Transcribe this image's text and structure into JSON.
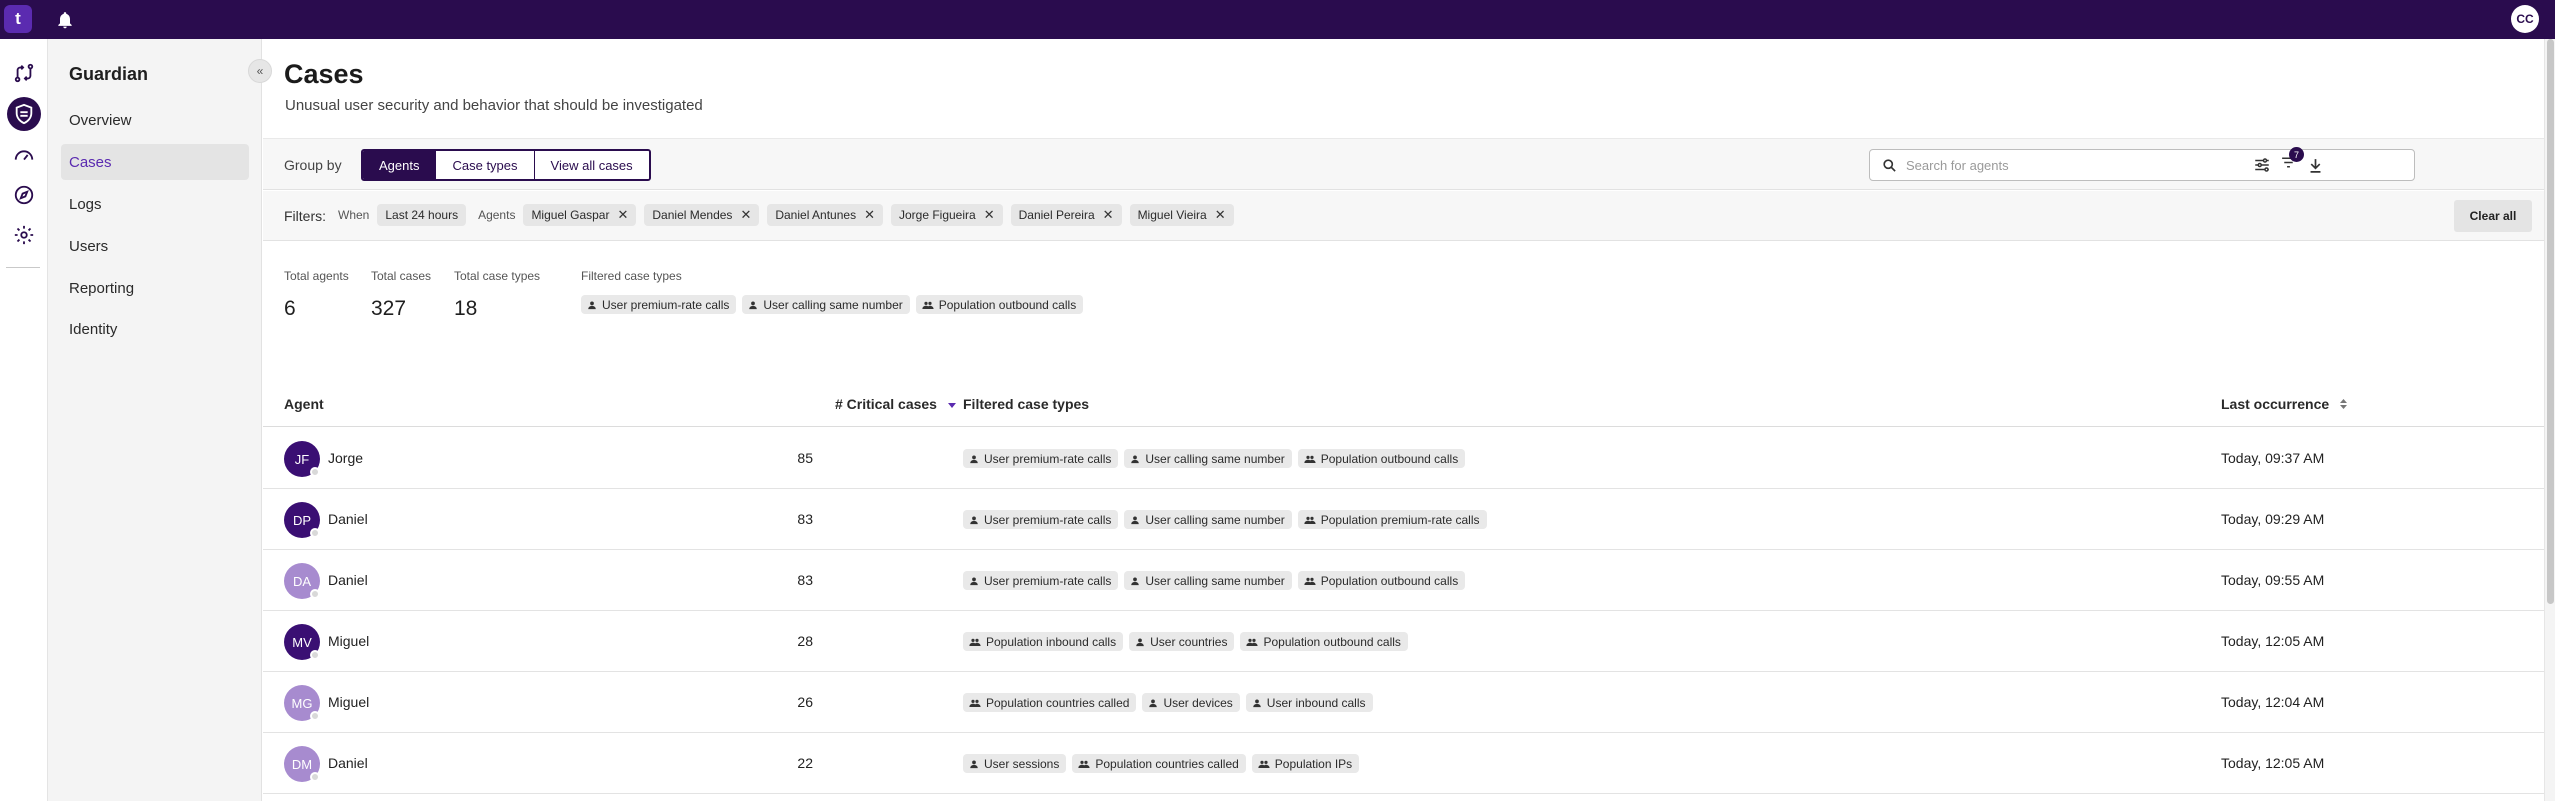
{
  "topbar": {
    "logo": "t",
    "user_initials": "CC"
  },
  "rail": {
    "icons": [
      "workflow-icon",
      "shield-icon",
      "speedometer-icon",
      "compass-icon",
      "gear-icon"
    ],
    "active_index": 1
  },
  "nav": {
    "title": "Guardian",
    "items": [
      {
        "label": "Overview",
        "active": false
      },
      {
        "label": "Cases",
        "active": true
      },
      {
        "label": "Logs",
        "active": false
      },
      {
        "label": "Users",
        "active": false
      },
      {
        "label": "Reporting",
        "active": false
      },
      {
        "label": "Identity",
        "active": false
      }
    ]
  },
  "page": {
    "title": "Cases",
    "subtitle": "Unusual user security and behavior that should be investigated"
  },
  "groupby": {
    "label": "Group by",
    "options": [
      {
        "label": "Agents",
        "selected": true
      },
      {
        "label": "Case types",
        "selected": false
      },
      {
        "label": "View all cases",
        "selected": false
      }
    ]
  },
  "search": {
    "placeholder": "Search for agents",
    "value": ""
  },
  "toolbar": {
    "filter_badge": "7"
  },
  "filters": {
    "label": "Filters:",
    "when_label": "When",
    "when_value": "Last 24 hours",
    "agents_label": "Agents",
    "agents": [
      "Miguel Gaspar",
      "Daniel Mendes",
      "Daniel Antunes",
      "Jorge Figueira",
      "Daniel Pereira",
      "Miguel Vieira"
    ],
    "clear_all": "Clear all"
  },
  "stats": {
    "total_agents_label": "Total agents",
    "total_agents": "6",
    "total_cases_label": "Total cases",
    "total_cases": "327",
    "total_case_types_label": "Total case types",
    "total_case_types": "18",
    "filtered_label": "Filtered case types",
    "filtered_types": [
      {
        "label": "User premium-rate calls",
        "kind": "user"
      },
      {
        "label": "User calling same number",
        "kind": "user"
      },
      {
        "label": "Population outbound calls",
        "kind": "population"
      }
    ]
  },
  "table": {
    "headers": {
      "agent": "Agent",
      "critical": "# Critical cases",
      "types": "Filtered case types",
      "last": "Last occurrence"
    },
    "rows": [
      {
        "initials": "JF",
        "name": "Jorge",
        "color": "#3a0f73",
        "count": "85",
        "last": "Today, 09:37 AM",
        "types": [
          {
            "label": "User premium-rate calls",
            "kind": "user"
          },
          {
            "label": "User calling same number",
            "kind": "user"
          },
          {
            "label": "Population outbound calls",
            "kind": "population"
          }
        ]
      },
      {
        "initials": "DP",
        "name": "Daniel",
        "color": "#3a0f73",
        "count": "83",
        "last": "Today, 09:29 AM",
        "types": [
          {
            "label": "User premium-rate calls",
            "kind": "user"
          },
          {
            "label": "User calling same number",
            "kind": "user"
          },
          {
            "label": "Population premium-rate calls",
            "kind": "population"
          }
        ]
      },
      {
        "initials": "DA",
        "name": "Daniel",
        "color": "#a78bcf",
        "count": "83",
        "last": "Today, 09:55 AM",
        "types": [
          {
            "label": "User premium-rate calls",
            "kind": "user"
          },
          {
            "label": "User calling same number",
            "kind": "user"
          },
          {
            "label": "Population outbound calls",
            "kind": "population"
          }
        ]
      },
      {
        "initials": "MV",
        "name": "Miguel",
        "color": "#3a0f73",
        "count": "28",
        "last": "Today, 12:05 AM",
        "types": [
          {
            "label": "Population inbound calls",
            "kind": "population"
          },
          {
            "label": "User countries",
            "kind": "user"
          },
          {
            "label": "Population outbound calls",
            "kind": "population"
          }
        ]
      },
      {
        "initials": "MG",
        "name": "Miguel",
        "color": "#a78bcf",
        "count": "26",
        "last": "Today, 12:04 AM",
        "types": [
          {
            "label": "Population countries called",
            "kind": "population"
          },
          {
            "label": "User devices",
            "kind": "user"
          },
          {
            "label": "User inbound calls",
            "kind": "user"
          }
        ]
      },
      {
        "initials": "DM",
        "name": "Daniel",
        "color": "#a78bcf",
        "count": "22",
        "last": "Today, 12:05 AM",
        "types": [
          {
            "label": "User sessions",
            "kind": "user"
          },
          {
            "label": "Population countries called",
            "kind": "population"
          },
          {
            "label": "Population IPs",
            "kind": "population"
          }
        ]
      }
    ]
  }
}
